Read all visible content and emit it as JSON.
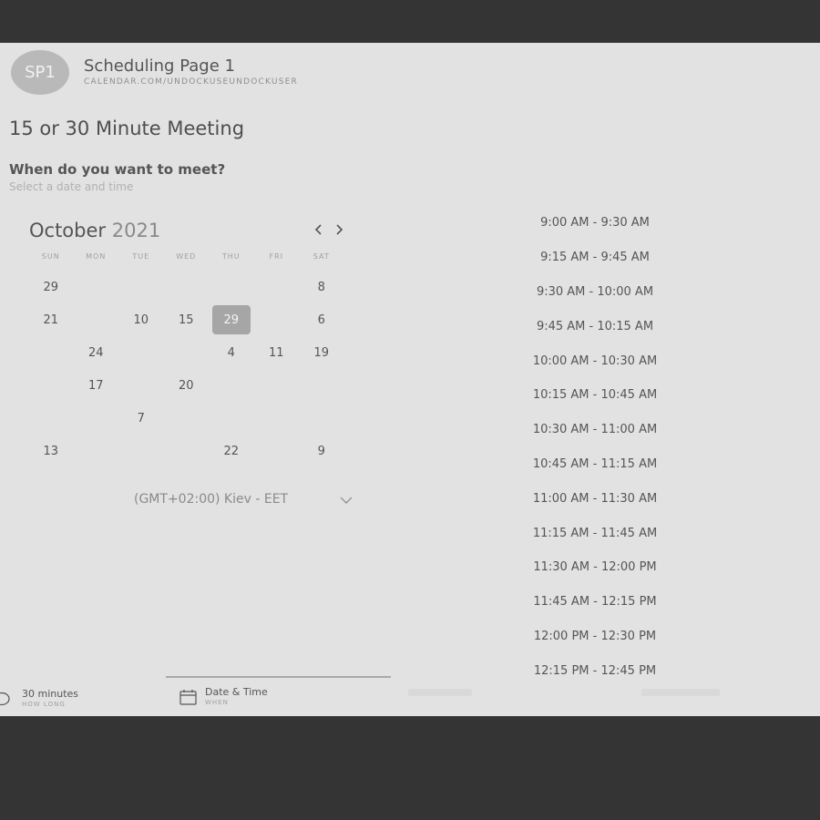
{
  "header": {
    "avatar_initials": "SP1",
    "page_name": "Scheduling Page 1",
    "page_url": "CALENDAR.COM/UNDOCKUSEUNDOCKUSER"
  },
  "meeting_title": "15 or 30 Minute Meeting",
  "question": "When do you want to meet?",
  "hint": "Select a date and time",
  "calendar": {
    "month": "October",
    "year": "2021",
    "prev_icon": "chevron-left-icon",
    "next_icon": "chevron-right-icon",
    "weekdays": [
      "SUN",
      "MON",
      "TUE",
      "WED",
      "THU",
      "FRI",
      "SAT"
    ],
    "weeks": [
      [
        "29",
        "",
        "",
        "",
        "",
        "",
        "8"
      ],
      [
        "21",
        "",
        "10",
        "15",
        "29",
        "",
        "6"
      ],
      [
        "",
        "24",
        "",
        "",
        "4",
        "11",
        "19"
      ],
      [
        "",
        "17",
        "",
        "20",
        "",
        "",
        ""
      ],
      [
        "",
        "",
        "7",
        "",
        "",
        "",
        ""
      ],
      [
        "13",
        "",
        "",
        "",
        "22",
        "",
        "9"
      ]
    ],
    "selected": "29"
  },
  "timezone": {
    "label": "(GMT+02:00) Kiev - EET",
    "icon": "chevron-down-icon"
  },
  "time_slots": [
    "9:00 AM - 9:30 AM",
    "9:15 AM - 9:45 AM",
    "9:30 AM - 10:00 AM",
    "9:45 AM - 10:15 AM",
    "10:00 AM - 10:30 AM",
    "10:15 AM - 10:45 AM",
    "10:30 AM - 11:00 AM",
    "10:45 AM - 11:15 AM",
    "11:00 AM - 11:30 AM",
    "11:15 AM - 11:45 AM",
    "11:30 AM - 12:00 PM",
    "11:45 AM - 12:15 PM",
    "12:00 PM - 12:30 PM",
    "12:15 PM - 12:45 PM"
  ],
  "footer": {
    "step1": {
      "label": "30 minutes",
      "sub": "HOW LONG",
      "icon": "clock-icon"
    },
    "step2": {
      "label": "Date & Time",
      "sub": "WHEN",
      "icon": "calendar-icon"
    }
  }
}
